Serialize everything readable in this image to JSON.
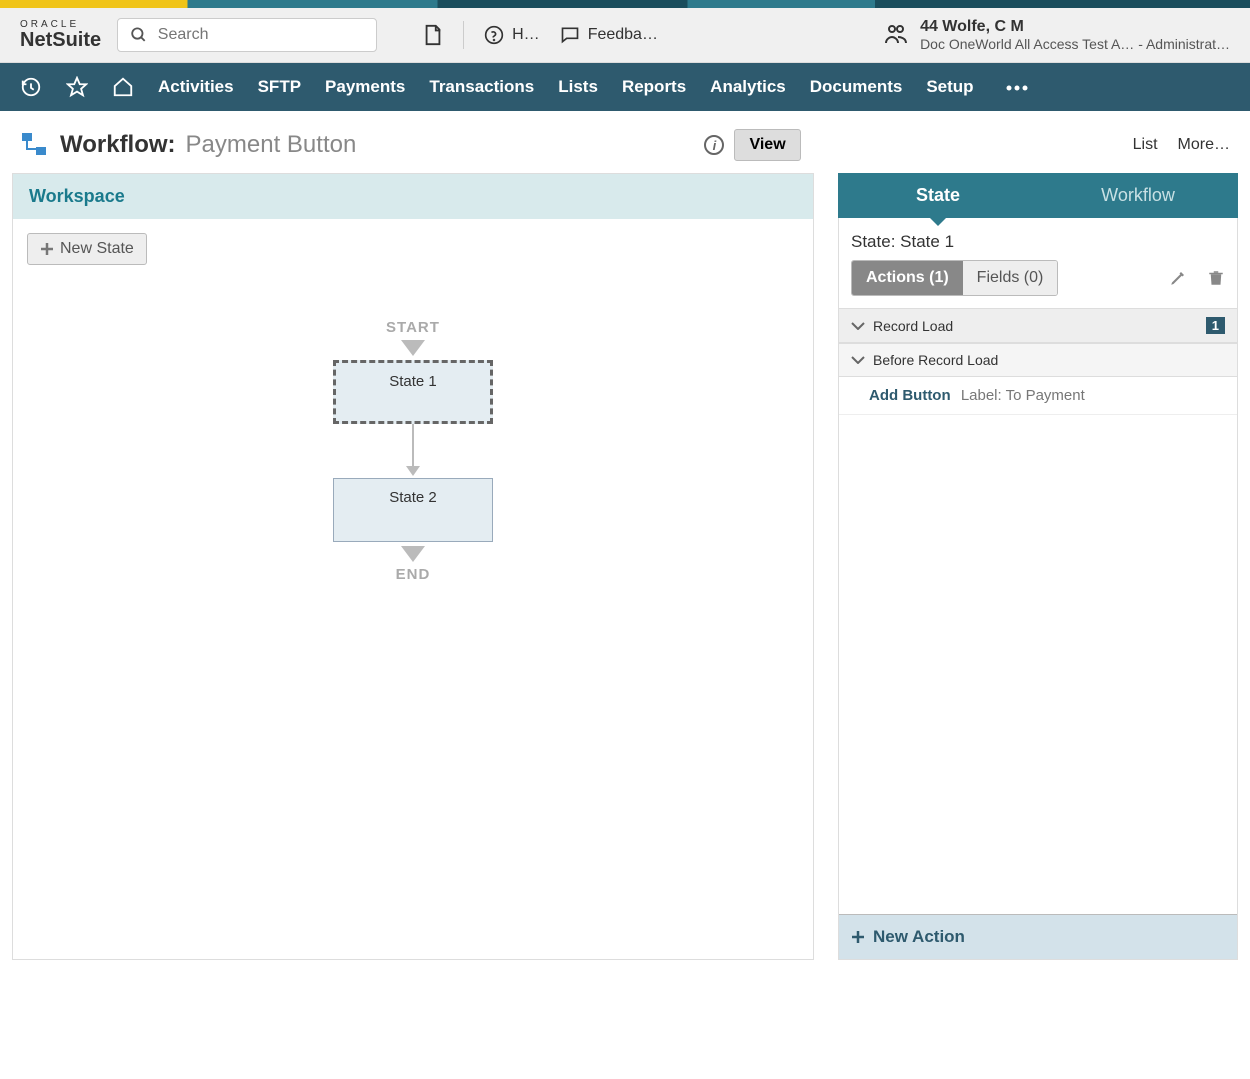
{
  "header": {
    "logo_top": "ORACLE",
    "logo_bottom": "NetSuite",
    "search_placeholder": "Search",
    "help_label": "H…",
    "feedback_label": "Feedba…",
    "user_name": "44 Wolfe, C M",
    "user_sub": "Doc OneWorld All Access Test A…  - Administrat…"
  },
  "nav": {
    "items": [
      "Activities",
      "SFTP",
      "Payments",
      "Transactions",
      "Lists",
      "Reports",
      "Analytics",
      "Documents",
      "Setup"
    ]
  },
  "page": {
    "title_label": "Workflow:",
    "title_name": "Payment Button",
    "view_button": "View",
    "list_link": "List",
    "more_link": "More…"
  },
  "workspace": {
    "header": "Workspace",
    "new_state_label": "New State",
    "start_label": "START",
    "end_label": "END",
    "state1": "State 1",
    "state2": "State 2"
  },
  "side": {
    "tab_state": "State",
    "tab_workflow": "Workflow",
    "state_label": "State:",
    "state_name": "State 1",
    "actions_pill": "Actions (1)",
    "fields_pill": "Fields (0)",
    "trigger1": "Record Load",
    "trigger1_count": "1",
    "trigger2": "Before Record Load",
    "action_name": "Add Button",
    "action_detail": "Label: To Payment",
    "new_action": "New Action"
  }
}
